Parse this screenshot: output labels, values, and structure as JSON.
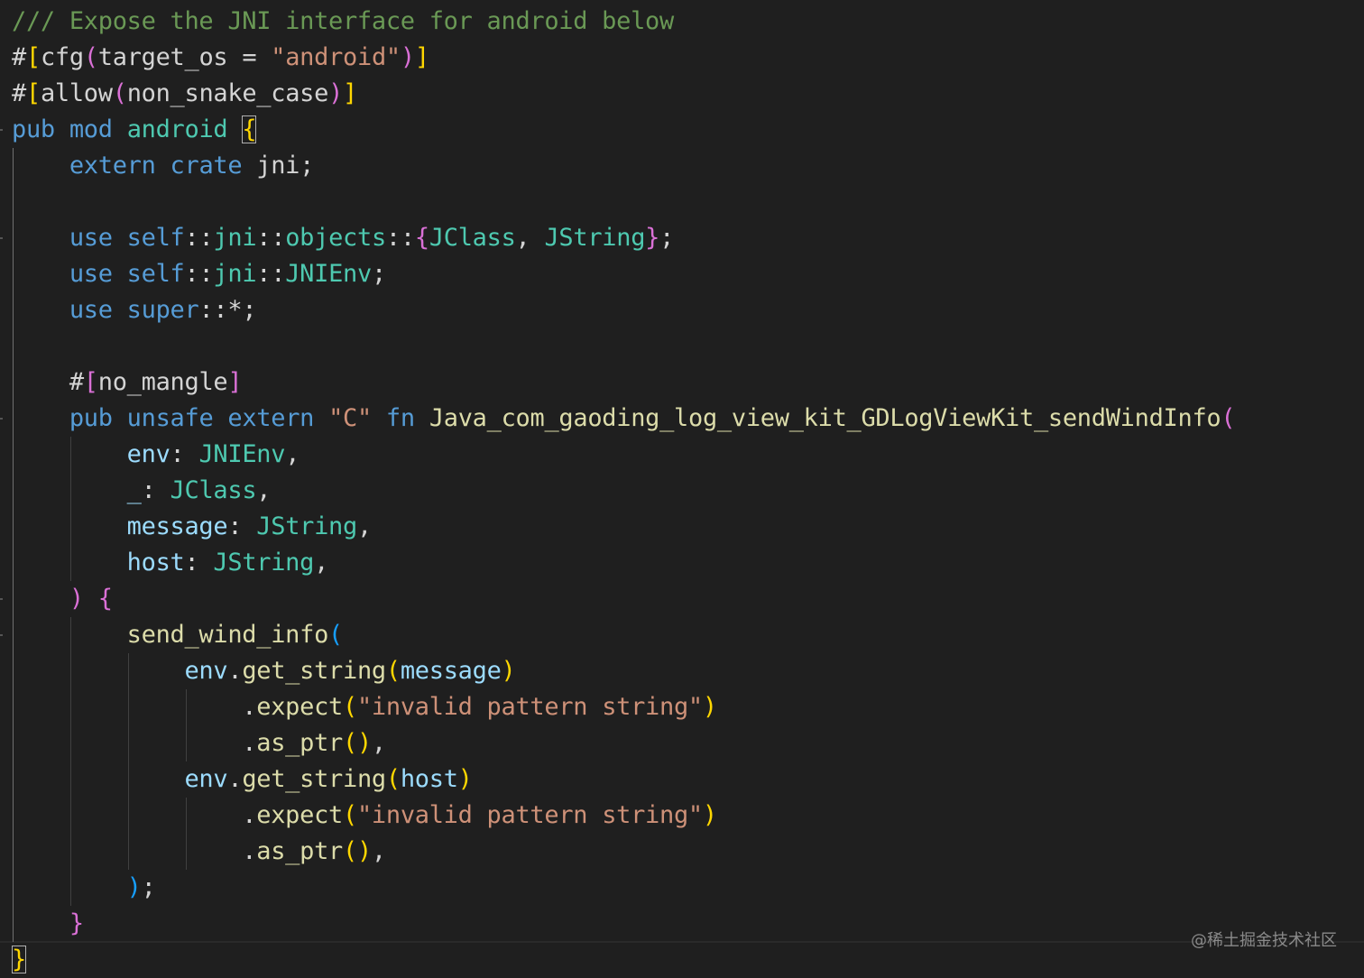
{
  "editor": {
    "language": "rust",
    "theme_colors": {
      "background": "#1f1f1f",
      "comment": "#6a9955",
      "keyword": "#569cd6",
      "type": "#4ec9b0",
      "string": "#ce9178",
      "function": "#dcdcaa",
      "variable": "#9cdcfe",
      "bracket_level_1": "#ffd700",
      "bracket_level_2": "#da70d6",
      "bracket_level_3": "#179fff"
    },
    "lines": [
      [
        [
          "comment",
          "/// Expose the JNI interface for android below"
        ]
      ],
      [
        [
          "macro",
          "#"
        ],
        [
          "b1",
          "["
        ],
        [
          "plain",
          "cfg"
        ],
        [
          "b2",
          "("
        ],
        [
          "plain",
          "target_os = "
        ],
        [
          "str",
          "\"android\""
        ],
        [
          "b2",
          ")"
        ],
        [
          "b1",
          "]"
        ]
      ],
      [
        [
          "macro",
          "#"
        ],
        [
          "b1",
          "["
        ],
        [
          "plain",
          "allow"
        ],
        [
          "b2",
          "("
        ],
        [
          "plain",
          "non_snake_case"
        ],
        [
          "b2",
          ")"
        ],
        [
          "b1",
          "]"
        ]
      ],
      [
        [
          "kw",
          "pub"
        ],
        [
          "plain",
          " "
        ],
        [
          "kw",
          "mod"
        ],
        [
          "plain",
          " "
        ],
        [
          "mod",
          "android"
        ],
        [
          "plain",
          " "
        ],
        [
          "b1m",
          "{"
        ]
      ],
      [
        [
          "plain",
          "    "
        ],
        [
          "kw",
          "extern"
        ],
        [
          "plain",
          " "
        ],
        [
          "kw",
          "crate"
        ],
        [
          "plain",
          " jni;"
        ]
      ],
      [],
      [
        [
          "plain",
          "    "
        ],
        [
          "kw",
          "use"
        ],
        [
          "plain",
          " "
        ],
        [
          "kw",
          "self"
        ],
        [
          "plain",
          "::"
        ],
        [
          "mod",
          "jni"
        ],
        [
          "plain",
          "::"
        ],
        [
          "mod",
          "objects"
        ],
        [
          "plain",
          "::"
        ],
        [
          "b2",
          "{"
        ],
        [
          "type",
          "JClass"
        ],
        [
          "plain",
          ", "
        ],
        [
          "type",
          "JString"
        ],
        [
          "b2",
          "}"
        ],
        [
          "plain",
          ";"
        ]
      ],
      [
        [
          "plain",
          "    "
        ],
        [
          "kw",
          "use"
        ],
        [
          "plain",
          " "
        ],
        [
          "kw",
          "self"
        ],
        [
          "plain",
          "::"
        ],
        [
          "mod",
          "jni"
        ],
        [
          "plain",
          "::"
        ],
        [
          "type",
          "JNIEnv"
        ],
        [
          "plain",
          ";"
        ]
      ],
      [
        [
          "plain",
          "    "
        ],
        [
          "kw",
          "use"
        ],
        [
          "plain",
          " "
        ],
        [
          "kw",
          "super"
        ],
        [
          "plain",
          "::*;"
        ]
      ],
      [],
      [
        [
          "plain",
          "    #"
        ],
        [
          "b2",
          "["
        ],
        [
          "plain",
          "no_mangle"
        ],
        [
          "b2",
          "]"
        ]
      ],
      [
        [
          "plain",
          "    "
        ],
        [
          "kw",
          "pub"
        ],
        [
          "plain",
          " "
        ],
        [
          "kw",
          "unsafe"
        ],
        [
          "plain",
          " "
        ],
        [
          "kw",
          "extern"
        ],
        [
          "plain",
          " "
        ],
        [
          "str",
          "\"C\""
        ],
        [
          "plain",
          " "
        ],
        [
          "kw",
          "fn"
        ],
        [
          "plain",
          " "
        ],
        [
          "fn",
          "Java_com_gaoding_log_view_kit_GDLogViewKit_sendWindInfo"
        ],
        [
          "b2",
          "("
        ]
      ],
      [
        [
          "plain",
          "        "
        ],
        [
          "var",
          "env"
        ],
        [
          "plain",
          ": "
        ],
        [
          "type",
          "JNIEnv"
        ],
        [
          "plain",
          ","
        ]
      ],
      [
        [
          "plain",
          "        "
        ],
        [
          "var",
          "_"
        ],
        [
          "plain",
          ": "
        ],
        [
          "type",
          "JClass"
        ],
        [
          "plain",
          ","
        ]
      ],
      [
        [
          "plain",
          "        "
        ],
        [
          "var",
          "message"
        ],
        [
          "plain",
          ": "
        ],
        [
          "type",
          "JString"
        ],
        [
          "plain",
          ","
        ]
      ],
      [
        [
          "plain",
          "        "
        ],
        [
          "var",
          "host"
        ],
        [
          "plain",
          ": "
        ],
        [
          "type",
          "JString"
        ],
        [
          "plain",
          ","
        ]
      ],
      [
        [
          "plain",
          "    "
        ],
        [
          "b2",
          ")"
        ],
        [
          "plain",
          " "
        ],
        [
          "b2",
          "{"
        ]
      ],
      [
        [
          "plain",
          "        "
        ],
        [
          "fn",
          "send_wind_info"
        ],
        [
          "b3",
          "("
        ]
      ],
      [
        [
          "plain",
          "            "
        ],
        [
          "var",
          "env"
        ],
        [
          "plain",
          "."
        ],
        [
          "fn",
          "get_string"
        ],
        [
          "b1",
          "("
        ],
        [
          "var",
          "message"
        ],
        [
          "b1",
          ")"
        ]
      ],
      [
        [
          "plain",
          "                ."
        ],
        [
          "fn",
          "expect"
        ],
        [
          "b1",
          "("
        ],
        [
          "str",
          "\"invalid pattern string\""
        ],
        [
          "b1",
          ")"
        ]
      ],
      [
        [
          "plain",
          "                ."
        ],
        [
          "fn",
          "as_ptr"
        ],
        [
          "b1",
          "()"
        ],
        [
          "plain",
          ","
        ]
      ],
      [
        [
          "plain",
          "            "
        ],
        [
          "var",
          "env"
        ],
        [
          "plain",
          "."
        ],
        [
          "fn",
          "get_string"
        ],
        [
          "b1",
          "("
        ],
        [
          "var",
          "host"
        ],
        [
          "b1",
          ")"
        ]
      ],
      [
        [
          "plain",
          "                ."
        ],
        [
          "fn",
          "expect"
        ],
        [
          "b1",
          "("
        ],
        [
          "str",
          "\"invalid pattern string\""
        ],
        [
          "b1",
          ")"
        ]
      ],
      [
        [
          "plain",
          "                ."
        ],
        [
          "fn",
          "as_ptr"
        ],
        [
          "b1",
          "()"
        ],
        [
          "plain",
          ","
        ]
      ],
      [
        [
          "plain",
          "        "
        ],
        [
          "b3",
          ")"
        ],
        [
          "plain",
          ";"
        ]
      ],
      [
        [
          "plain",
          "    "
        ],
        [
          "b2",
          "}"
        ]
      ],
      [
        [
          "b1m",
          "}"
        ]
      ]
    ]
  },
  "watermark": "@稀土掘金技术社区"
}
